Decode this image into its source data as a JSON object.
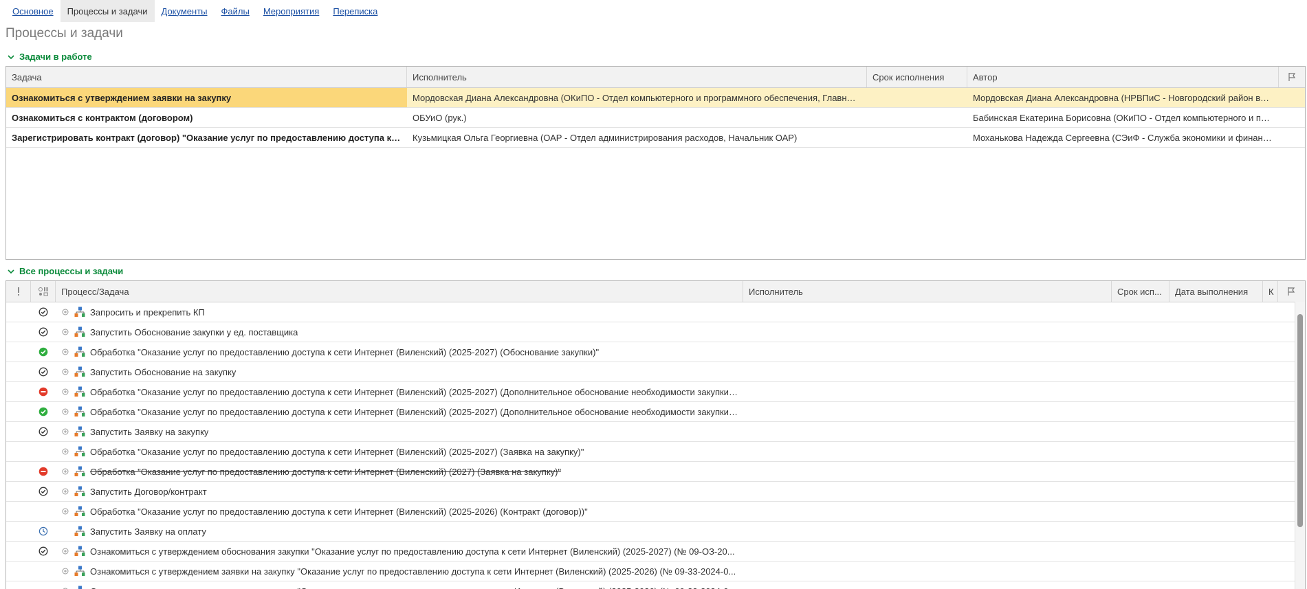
{
  "tabs": [
    "Основное",
    "Процессы и задачи",
    "Документы",
    "Файлы",
    "Мероприятия",
    "Переписка"
  ],
  "active_tab": "Процессы и задачи",
  "page_title": "Процессы и задачи",
  "tasks_group": {
    "title": "Задачи в работе",
    "columns": {
      "task": "Задача",
      "executor": "Исполнитель",
      "deadline": "Срок исполнения",
      "author": "Автор",
      "flag_icon": "flag-icon"
    },
    "rows": [
      {
        "task": "Ознакомиться с утверждением заявки на закупку",
        "executor": "Мордовская Диана Александровна (ОКиПО - Отдел компьютерного и программного обеспечения, Главный специалист ОКиПО)",
        "deadline": "",
        "author": "Мордовская Диана Александровна (НРВПиС - Новгородский район водопроводных сетей)",
        "selected": true
      },
      {
        "task": "Ознакомиться с контрактом (договором)",
        "executor": "ОБУиО (рук.)",
        "deadline": "",
        "author": "Бабинская Екатерина Борисовна (ОКиПО - Отдел компьютерного и программного обеспечения)",
        "selected": false
      },
      {
        "task": "Зарегистрировать контракт (договор) \"Оказание услуг по предоставлению доступа к сети Интернет\"",
        "executor": "Кузьмицкая Ольга Георгиевна (ОАР - Отдел администрирования расходов, Начальник ОАР)",
        "deadline": "",
        "author": "Моханькова Надежда Сергеевна (СЭиФ - Служба экономики и финансов)",
        "selected": false
      }
    ]
  },
  "all_group": {
    "title": "Все процессы и задачи",
    "columns": {
      "importance_icon": "exclamation-icon",
      "state_icon": "state-columns-icon",
      "process": "Процесс/Задача",
      "executor": "Исполнитель",
      "deadline": "Срок исп...",
      "done_date": "Дата выполнения",
      "k": "К",
      "flag_icon": "flag-icon"
    },
    "rows": [
      {
        "status": "check",
        "expand": true,
        "text": "Запросить и прекрепить КП",
        "strike": false
      },
      {
        "status": "check",
        "expand": true,
        "text": "Запустить Обоснование закупки у ед. поставщика",
        "strike": false
      },
      {
        "status": "green",
        "expand": true,
        "text": "Обработка \"Оказание услуг по предоставлению доступа к сети Интернет (Виленский) (2025-2027) (Обоснование закупки)\"",
        "strike": false
      },
      {
        "status": "check",
        "expand": true,
        "text": "Запустить Обоснование на закупку",
        "strike": false
      },
      {
        "status": "red",
        "expand": true,
        "text": "Обработка \"Оказание услуг по предоставлению доступа к сети Интернет (Виленский) (2025-2027) (Дополнительное обоснование необходимости закупки ...",
        "strike": false
      },
      {
        "status": "green",
        "expand": true,
        "text": "Обработка \"Оказание услуг по предоставлению доступа к сети Интернет (Виленский) (2025-2027) (Дополнительное обоснование необходимости закупки ...",
        "strike": false
      },
      {
        "status": "check",
        "expand": true,
        "text": "Запустить Заявку на закупку",
        "strike": false
      },
      {
        "status": "none",
        "expand": true,
        "text": "Обработка \"Оказание услуг по предоставлению доступа к сети Интернет (Виленский) (2025-2027) (Заявка на закупку)\"",
        "strike": false
      },
      {
        "status": "red",
        "expand": true,
        "text": "Обработка \"Оказание услуг по предоставлению доступа к сети Интернет (Виленский) (2027) (Заявка на закупку)\"",
        "strike": true
      },
      {
        "status": "check",
        "expand": true,
        "text": "Запустить Договор/контракт",
        "strike": false
      },
      {
        "status": "none",
        "expand": true,
        "text": "Обработка \"Оказание услуг по предоставлению доступа к сети Интернет (Виленский) (2025-2026) (Контракт (договор))\"",
        "strike": false
      },
      {
        "status": "clock",
        "expand": false,
        "text": "Запустить Заявку на оплату",
        "strike": false
      },
      {
        "status": "check",
        "expand": true,
        "text": "Ознакомиться с утверждением обоснования закупки \"Оказание услуг по предоставлению доступа к сети Интернет (Виленский) (2025-2027) (№ 09-ОЗ-20...",
        "strike": false
      },
      {
        "status": "none",
        "expand": true,
        "text": "Ознакомиться с утверждением заявки на закупку \"Оказание услуг по предоставлению доступа к сети Интернет (Виленский) (2025-2026) (№ 09-33-2024-0...",
        "strike": false
      },
      {
        "status": "none",
        "expand": true,
        "text": "Ознакомиться с утверждением заявки на закупку \"Оказание услуг по предоставлению доступа к сети Интернет (Виленский) (2025-2026) (№ 09-33-2024-0...",
        "strike": false
      }
    ]
  },
  "colors": {
    "link": "#1a4fa3",
    "group_title": "#0a8a3a",
    "selected_row": "#fdf1c4",
    "selected_cell": "#fbd77a",
    "status_green": "#2fae3f",
    "status_red": "#e23a2a"
  }
}
